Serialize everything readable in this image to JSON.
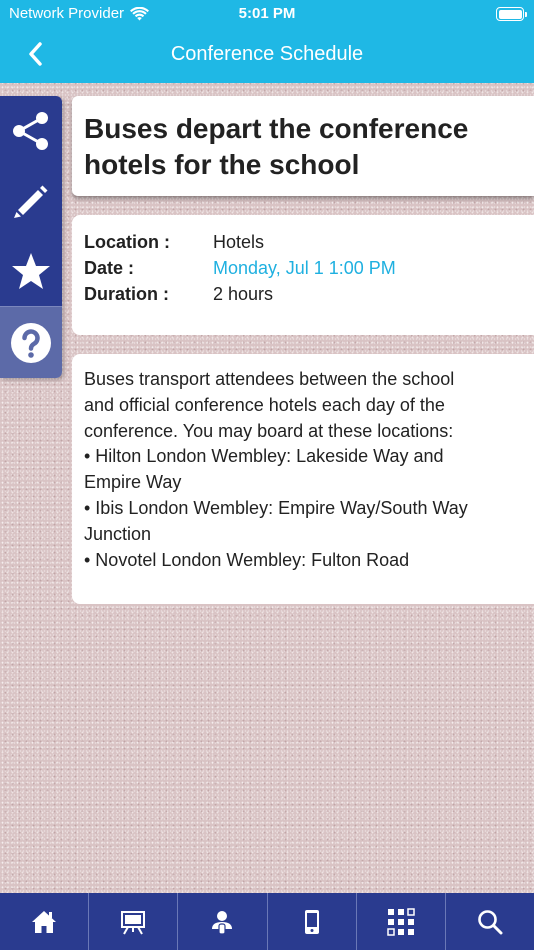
{
  "status_bar": {
    "carrier": "Network Provider",
    "time": "5:01 PM",
    "wifi_icon": "wifi-icon",
    "battery_icon": "battery-icon"
  },
  "nav": {
    "title": "Conference Schedule",
    "back_icon": "chevron-left-icon"
  },
  "side_actions": [
    {
      "icon": "share-icon"
    },
    {
      "icon": "pencil-icon"
    },
    {
      "icon": "star-icon"
    },
    {
      "icon": "help-icon"
    }
  ],
  "event": {
    "title_lines": [
      "Buses depart the conference",
      "hotels for the school"
    ],
    "details": {
      "location_label": "Location :",
      "location_value": "Hotels",
      "date_label": "Date :",
      "date_value": "Monday, Jul 1 1:00 PM",
      "duration_label": "Duration :",
      "duration_value": "2 hours"
    },
    "description_lines": [
      "Buses transport attendees between the school",
      "and official conference hotels each day of the",
      "conference. You may board at these locations:",
      "• Hilton London Wembley: Lakeside Way and",
      "Empire Way",
      "• Ibis London Wembley: Empire Way/South Way",
      "Junction",
      "• Novotel London Wembley: Fulton Road"
    ]
  },
  "tab_bar": [
    {
      "icon": "home-icon"
    },
    {
      "icon": "presentation-icon"
    },
    {
      "icon": "speaker-icon"
    },
    {
      "icon": "phone-icon"
    },
    {
      "icon": "qr-grid-icon"
    },
    {
      "icon": "search-icon"
    }
  ],
  "colors": {
    "header": "#1fb8e5",
    "rail": "#2a3b8f",
    "rail_help": "#5c6aa8",
    "link": "#1fb0e0",
    "tab_bar": "#2a3b8f"
  }
}
